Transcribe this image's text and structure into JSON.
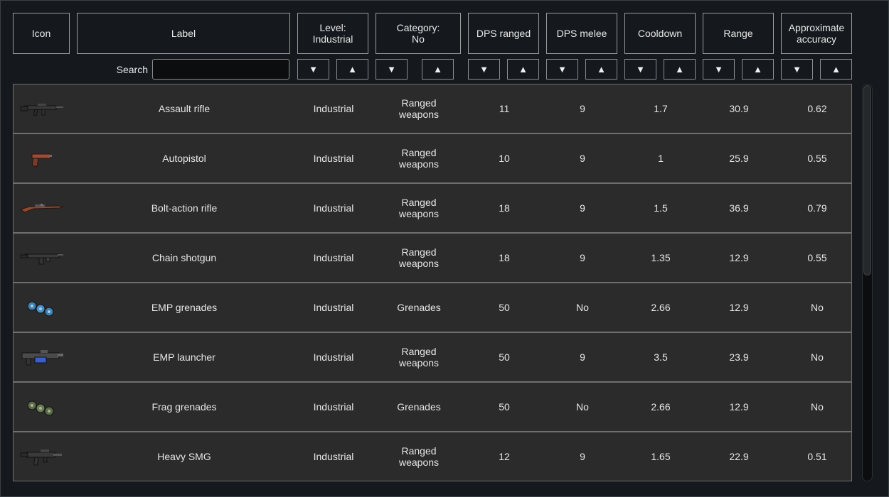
{
  "headers": {
    "icon": "Icon",
    "label": "Label",
    "level_line1": "Level:",
    "level_line2": "Industrial",
    "category_line1": "Category:",
    "category_line2": "No",
    "dps_ranged": "DPS ranged",
    "dps_melee": "DPS melee",
    "cooldown": "Cooldown",
    "range": "Range",
    "accuracy_line1": "Approximate",
    "accuracy_line2": "accuracy"
  },
  "search": {
    "label": "Search",
    "value": ""
  },
  "sort": {
    "desc": "▼",
    "asc": "▲"
  },
  "rows": [
    {
      "icon": "assault-rifle-icon",
      "label": "Assault rifle",
      "level": "Industrial",
      "cat1": "Ranged",
      "cat2": "weapons",
      "dps_ranged": "11",
      "dps_melee": "9",
      "cooldown": "1.7",
      "range": "30.9",
      "accuracy": "0.62"
    },
    {
      "icon": "autopistol-icon",
      "label": "Autopistol",
      "level": "Industrial",
      "cat1": "Ranged",
      "cat2": "weapons",
      "dps_ranged": "10",
      "dps_melee": "9",
      "cooldown": "1",
      "range": "25.9",
      "accuracy": "0.55"
    },
    {
      "icon": "bolt-action-rifle-icon",
      "label": "Bolt-action rifle",
      "level": "Industrial",
      "cat1": "Ranged",
      "cat2": "weapons",
      "dps_ranged": "18",
      "dps_melee": "9",
      "cooldown": "1.5",
      "range": "36.9",
      "accuracy": "0.79"
    },
    {
      "icon": "chain-shotgun-icon",
      "label": "Chain shotgun",
      "level": "Industrial",
      "cat1": "Ranged",
      "cat2": "weapons",
      "dps_ranged": "18",
      "dps_melee": "9",
      "cooldown": "1.35",
      "range": "12.9",
      "accuracy": "0.55"
    },
    {
      "icon": "emp-grenades-icon",
      "label": "EMP grenades",
      "level": "Industrial",
      "cat1": "Grenades",
      "cat2": "",
      "dps_ranged": "50",
      "dps_melee": "No",
      "cooldown": "2.66",
      "range": "12.9",
      "accuracy": "No"
    },
    {
      "icon": "emp-launcher-icon",
      "label": "EMP launcher",
      "level": "Industrial",
      "cat1": "Ranged",
      "cat2": "weapons",
      "dps_ranged": "50",
      "dps_melee": "9",
      "cooldown": "3.5",
      "range": "23.9",
      "accuracy": "No"
    },
    {
      "icon": "frag-grenades-icon",
      "label": "Frag grenades",
      "level": "Industrial",
      "cat1": "Grenades",
      "cat2": "",
      "dps_ranged": "50",
      "dps_melee": "No",
      "cooldown": "2.66",
      "range": "12.9",
      "accuracy": "No"
    },
    {
      "icon": "heavy-smg-icon",
      "label": "Heavy SMG",
      "level": "Industrial",
      "cat1": "Ranged",
      "cat2": "weapons",
      "dps_ranged": "12",
      "dps_melee": "9",
      "cooldown": "1.65",
      "range": "22.9",
      "accuracy": "0.51"
    }
  ],
  "colors": {
    "background": "#15191d",
    "row": "#2b2b2b",
    "border": "#9b9b9b"
  }
}
